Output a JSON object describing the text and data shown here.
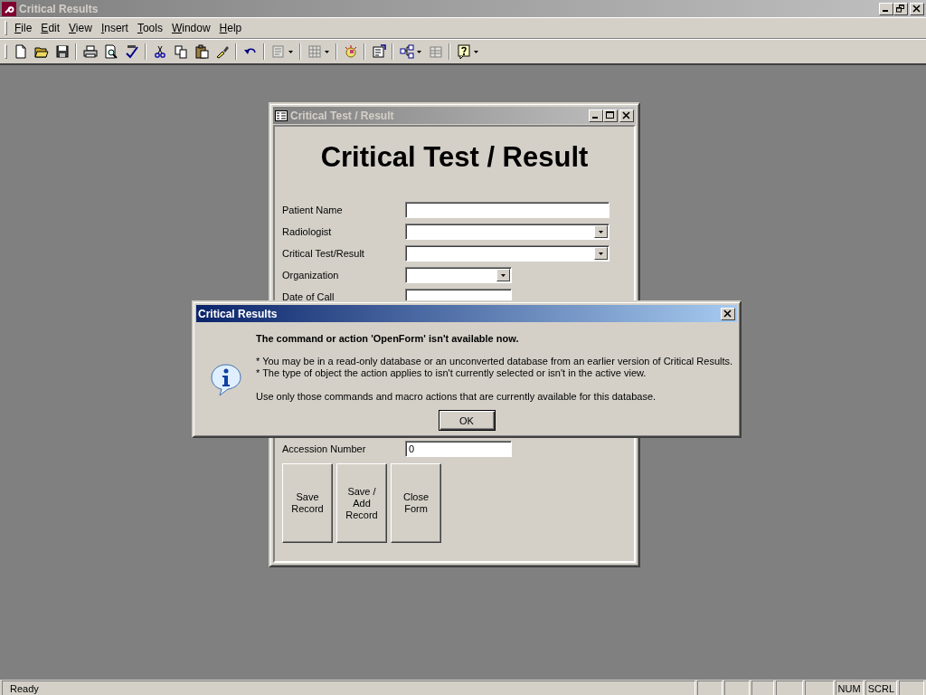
{
  "window": {
    "title": "Critical Results"
  },
  "menu": [
    "File",
    "Edit",
    "View",
    "Insert",
    "Tools",
    "Window",
    "Help"
  ],
  "form_window": {
    "title": "Critical Test / Result"
  },
  "form": {
    "heading": "Critical Test / Result",
    "fields": [
      {
        "label": "Patient Name",
        "kind": "text-wide"
      },
      {
        "label": "Radiologist",
        "kind": "combo-wide"
      },
      {
        "label": "Critical Test/Result",
        "kind": "combo-wide"
      },
      {
        "label": "Organization",
        "kind": "combo-narrow"
      },
      {
        "label": "Date of Call",
        "kind": "text-narrow"
      },
      {
        "label": "Accession Number",
        "kind": "text-narrow",
        "value": "0"
      }
    ],
    "buttons": [
      "Save Record",
      "Save / Add Record",
      "Close Form"
    ]
  },
  "dialog": {
    "title": "Critical Results",
    "message": "The command or action 'OpenForm' isn't available now.",
    "details": [
      "* You may be in a read-only database or an unconverted database from an earlier version of Critical Results.",
      "* The type of object the action applies to isn't currently selected or isn't in the active view."
    ],
    "note": "Use only those commands and macro actions that are currently available for this database.",
    "button": "OK"
  },
  "status_bar": {
    "text": "Ready",
    "indicators": [
      "NUM",
      "SCRL"
    ]
  }
}
